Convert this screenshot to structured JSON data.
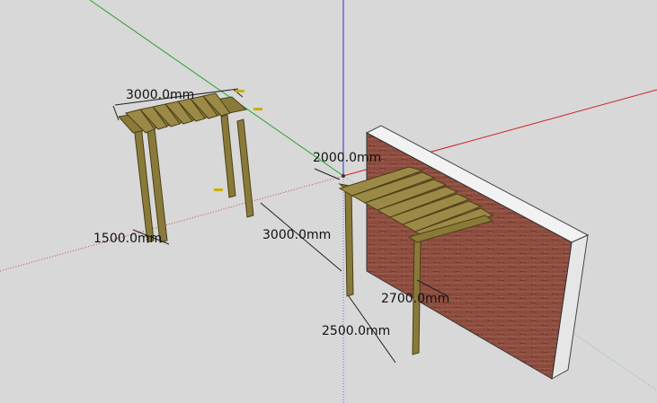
{
  "scene": {
    "background": "#d8d8d8",
    "axis_colors": {
      "red": "#cc2222",
      "green": "#22aa22",
      "blue": "#2222cc"
    },
    "wood_color": "#8a7a3a",
    "brick_color": "#8b4a3c"
  },
  "dimensions": {
    "left_pergola_width": "3000.0mm",
    "left_pergola_depth": "1500.0mm",
    "right_pergola_depth": "2000.0mm",
    "right_pergola_width": "3000.0mm",
    "wall_height": "2700.0mm",
    "post_height": "2500.0mm"
  },
  "icons": [
    "origin-axes-icon"
  ]
}
